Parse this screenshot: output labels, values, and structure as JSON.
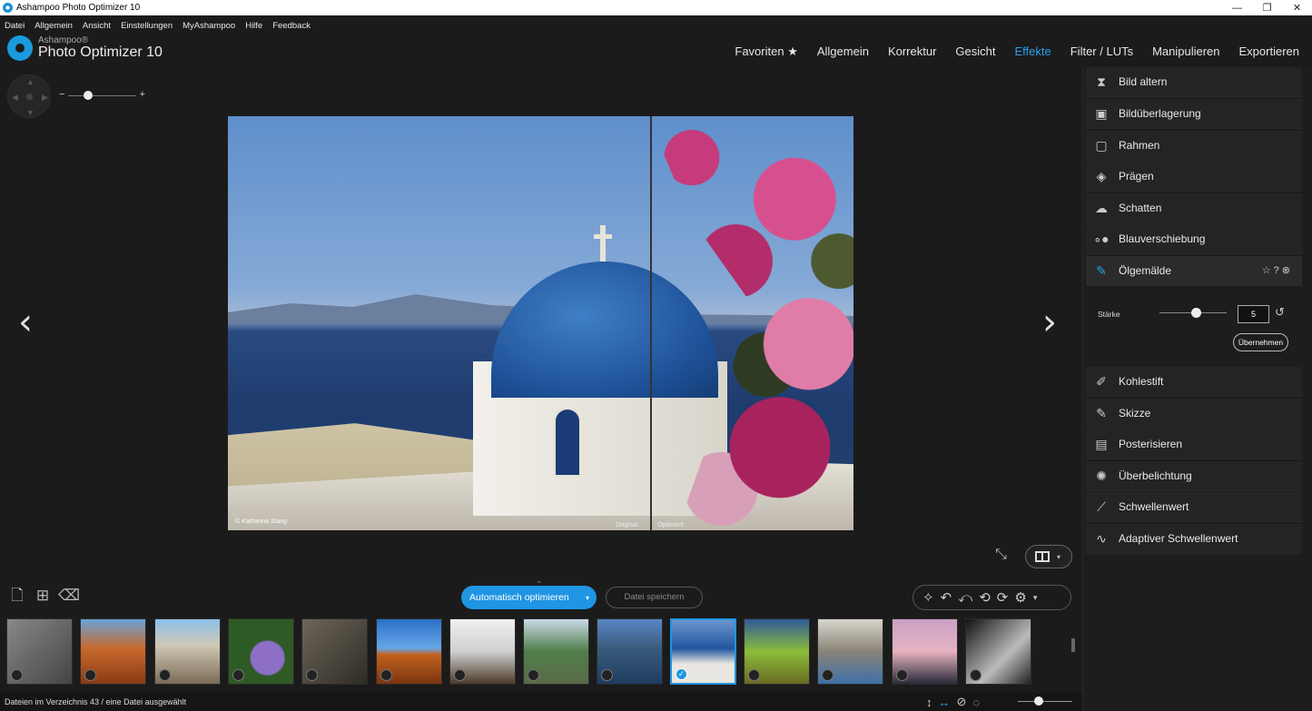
{
  "window": {
    "title": "Ashampoo Photo Optimizer 10",
    "controls": [
      "—",
      "❐",
      "✕"
    ]
  },
  "menu": [
    "Datei",
    "Allgemein",
    "Ansicht",
    "Einstellungen",
    "MyAshampoo",
    "Hilfe",
    "Feedback"
  ],
  "logo": {
    "brand": "Ashampoo®",
    "product": "Photo Optimizer 10"
  },
  "topnav": {
    "items": [
      "Favoriten ★",
      "Allgemein",
      "Korrektur",
      "Gesicht",
      "Effekte",
      "Filter / LUTs",
      "Manipulieren",
      "Exportieren"
    ],
    "active": "Effekte",
    "active_color": "#2aa0ea"
  },
  "photo": {
    "caption": "© Katharina Stang",
    "label_original": "Original",
    "label_optimized": "Optimiert"
  },
  "panel": {
    "items": [
      {
        "label": "Bild altern",
        "icon": "hourglass-icon"
      },
      {
        "label": "Bildüberlagerung",
        "icon": "overlay-icon"
      },
      {
        "label": "Rahmen",
        "icon": "frame-icon"
      },
      {
        "label": "Prägen",
        "icon": "emboss-icon"
      },
      {
        "label": "Schatten",
        "icon": "shadow-icon"
      },
      {
        "label": "Blauverschiebung",
        "icon": "dots-icon"
      },
      {
        "label": "Ölgemälde",
        "icon": "brush-icon"
      },
      {
        "label": "Kohlestift",
        "icon": "pencil-icon"
      },
      {
        "label": "Skizze",
        "icon": "pencil-icon"
      },
      {
        "label": "Posterisieren",
        "icon": "poster-icon"
      },
      {
        "label": "Überbelichtung",
        "icon": "exposure-icon"
      },
      {
        "label": "Schwellenwert",
        "icon": "threshold-icon"
      },
      {
        "label": "Adaptiver Schwellenwert",
        "icon": "adaptive-threshold-icon"
      }
    ],
    "active_item": "Ölgemälde",
    "strength_label": "Stärke",
    "strength_value": "5",
    "apply_label": "Übernehmen"
  },
  "toolbar": {
    "auto_optimize": "Automatisch optimieren",
    "save_file": "Datei speichern"
  },
  "thumbnails": {
    "count": 14,
    "selected_index": 9
  },
  "status": {
    "text": "Dateien im Verzeichnis 43 / eine Datei ausgewählt"
  },
  "colors": {
    "accent": "#1f95e3",
    "background": "#1b1b1b"
  }
}
